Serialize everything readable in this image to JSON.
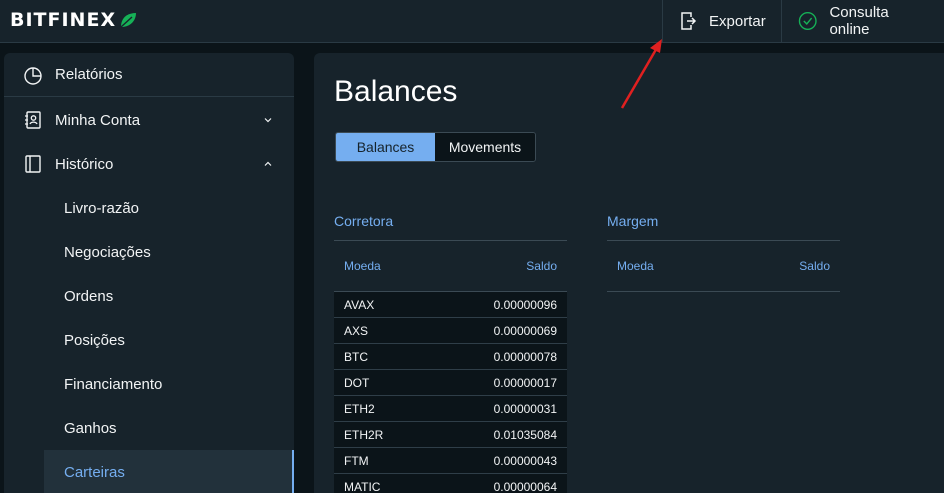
{
  "header": {
    "logo_text": "BITFINEX",
    "export_label": "Exportar",
    "online_label": "Consulta online"
  },
  "sidebar": {
    "items": [
      {
        "label": "Relatórios",
        "icon": "pie-chart-icon"
      },
      {
        "label": "Minha Conta",
        "icon": "account-icon"
      },
      {
        "label": "Histórico",
        "icon": "history-icon"
      }
    ],
    "sub_items": [
      {
        "label": "Livro-razão"
      },
      {
        "label": "Negociações"
      },
      {
        "label": "Ordens"
      },
      {
        "label": "Posições"
      },
      {
        "label": "Financiamento"
      },
      {
        "label": "Ganhos"
      },
      {
        "label": "Carteiras"
      }
    ],
    "active_sub_item": "Carteiras"
  },
  "main": {
    "title": "Balances",
    "tabs": [
      {
        "label": "Balances",
        "active": true
      },
      {
        "label": "Movements",
        "active": false
      }
    ],
    "exchange": {
      "title": "Corretora",
      "col_currency": "Moeda",
      "col_balance": "Saldo",
      "rows": [
        {
          "currency": "AVAX",
          "balance": "0.00000096"
        },
        {
          "currency": "AXS",
          "balance": "0.00000069"
        },
        {
          "currency": "BTC",
          "balance": "0.00000078"
        },
        {
          "currency": "DOT",
          "balance": "0.00000017"
        },
        {
          "currency": "ETH2",
          "balance": "0.00000031"
        },
        {
          "currency": "ETH2R",
          "balance": "0.01035084"
        },
        {
          "currency": "FTM",
          "balance": "0.00000043"
        },
        {
          "currency": "MATIC",
          "balance": "0.00000064"
        }
      ]
    },
    "margin": {
      "title": "Margem",
      "col_currency": "Moeda",
      "col_balance": "Saldo",
      "rows": []
    }
  },
  "colors": {
    "accent": "#75aef0",
    "brand_leaf": "#16b157",
    "online_check": "#16b157",
    "annotation_arrow": "#e02020"
  }
}
